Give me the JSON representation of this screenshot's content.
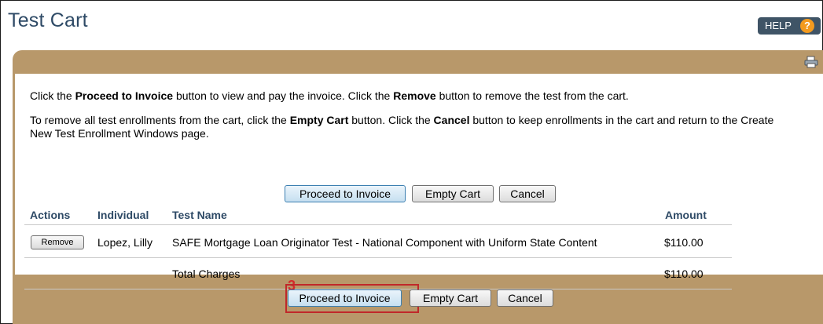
{
  "page": {
    "title": "Test Cart"
  },
  "help": {
    "label": "HELP",
    "icon_glyph": "?"
  },
  "instructions": {
    "p1": [
      {
        "text": "Click the ",
        "bold": false
      },
      {
        "text": "Proceed to Invoice",
        "bold": true
      },
      {
        "text": " button to view and pay the invoice. Click the ",
        "bold": false
      },
      {
        "text": "Remove",
        "bold": true
      },
      {
        "text": " button to remove the test from the cart.",
        "bold": false
      }
    ],
    "p2": [
      {
        "text": "To remove all test enrollments from the cart, click the ",
        "bold": false
      },
      {
        "text": "Empty Cart",
        "bold": true
      },
      {
        "text": " button. Click the ",
        "bold": false
      },
      {
        "text": "Cancel",
        "bold": true
      },
      {
        "text": " button to keep enrollments in the cart and return to the Create New Test Enrollment Windows page.",
        "bold": false
      }
    ]
  },
  "buttons": {
    "proceed": "Proceed to Invoice",
    "empty": "Empty Cart",
    "cancel": "Cancel",
    "remove": "Remove"
  },
  "table": {
    "headers": {
      "actions": "Actions",
      "individual": "Individual",
      "test_name": "Test Name",
      "amount": "Amount"
    },
    "rows": [
      {
        "individual": "Lopez, Lilly",
        "test_name": "SAFE Mortgage Loan Originator Test - National Component with Uniform State Content",
        "amount": "$110.00"
      }
    ],
    "total": {
      "label": "Total Charges",
      "amount": "$110.00"
    }
  },
  "annotation": {
    "step": "3"
  },
  "colors": {
    "title": "#2e4a66",
    "panel": "#b8986a",
    "highlight": "#c0282a",
    "help_badge": "#f39a1e"
  },
  "icons": {
    "print": "printer-icon",
    "help": "question-icon"
  }
}
